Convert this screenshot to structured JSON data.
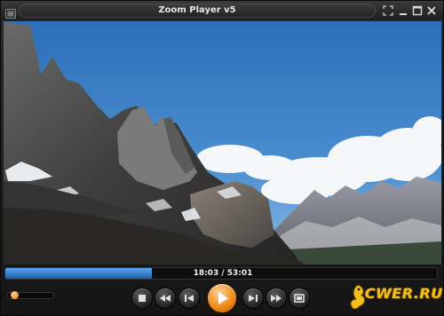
{
  "window": {
    "title": "Zoom Player v5"
  },
  "icons": {
    "app": "zoom-player-logo-icon",
    "fullscreen": "fullscreen-icon",
    "minimize": "minimize-icon",
    "maximize": "maximize-icon",
    "close": "close-icon",
    "stop": "stop-icon",
    "rewind": "rewind-icon",
    "previous": "skip-previous-icon",
    "play": "play-icon",
    "next": "skip-next-icon",
    "forward": "fast-forward-icon",
    "frame_step": "frame-step-icon"
  },
  "playback": {
    "position_label": "18:03 / 53:01",
    "progress_fraction": 0.34,
    "volume_fraction": 0.1
  },
  "watermark": {
    "text": "CWER.RU"
  },
  "colors": {
    "accent_orange": "#f08c1a",
    "seek_blue": "#2f7fd0",
    "chrome_dark": "#1b1b1b",
    "title_text": "#e6e6e6"
  }
}
